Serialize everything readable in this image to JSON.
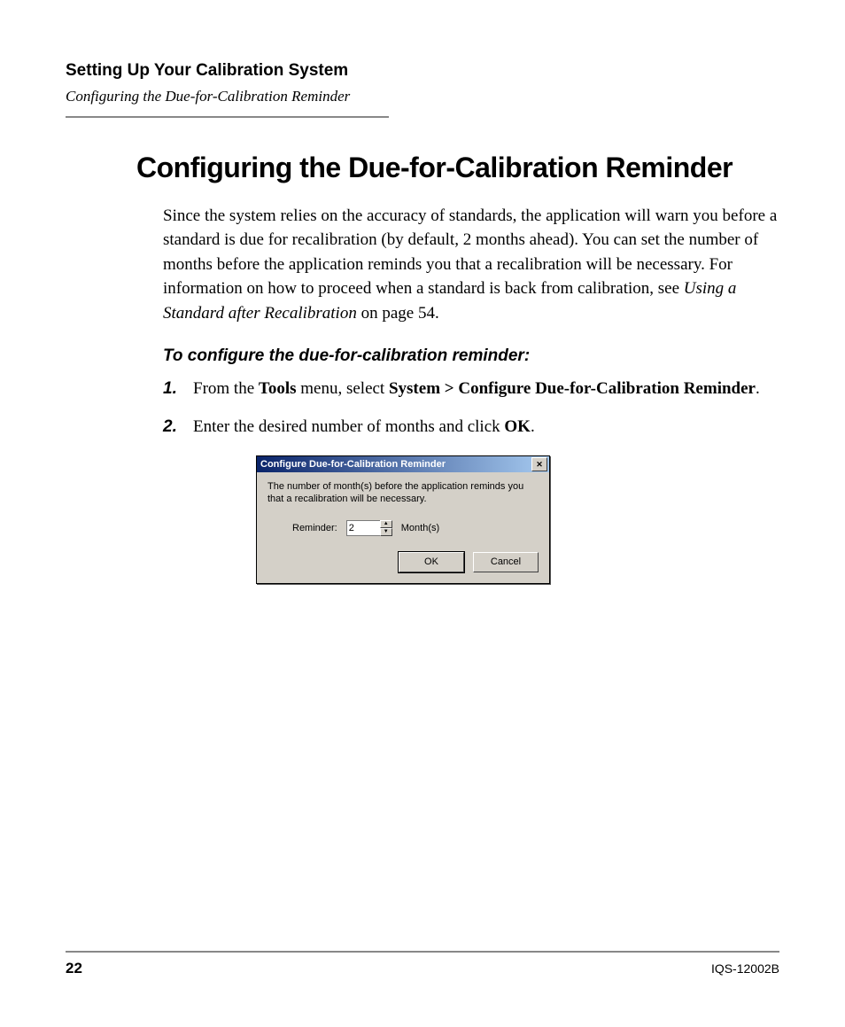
{
  "header": {
    "chapter": "Setting Up Your Calibration System",
    "section": "Configuring the Due-for-Calibration Reminder"
  },
  "heading": "Configuring the Due-for-Calibration Reminder",
  "intro": {
    "pre": "Since the system relies on the accuracy of standards, the application will warn you before a standard is due for recalibration (by default, 2 months ahead). You can set the number of months before the application reminds you that a recalibration will be necessary. For information on how to proceed when a standard is back from calibration, see ",
    "xref": "Using a Standard after Recalibration",
    "post": " on page 54."
  },
  "task_head": "To configure the due-for-calibration reminder:",
  "steps": {
    "s1": {
      "num": "1.",
      "a": "From the ",
      "b1": "Tools",
      "b": " menu, select ",
      "b2": "System > Configure Due-for-Calibration Reminder",
      "c": "."
    },
    "s2": {
      "num": "2.",
      "a": "Enter the desired number of months and click ",
      "b1": "OK",
      "b": "."
    }
  },
  "dialog": {
    "title": "Configure Due-for-Calibration Reminder",
    "description": "The number of month(s) before the application reminds you that a recalibration will be necessary.",
    "reminder_label": "Reminder:",
    "reminder_value": "2",
    "unit": "Month(s)",
    "ok": "OK",
    "cancel": "Cancel"
  },
  "footer": {
    "page": "22",
    "doc_id": "IQS-12002B"
  }
}
